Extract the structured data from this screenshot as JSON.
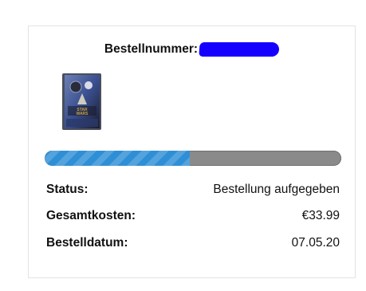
{
  "order": {
    "number_label": "Bestellnummer:",
    "number_redaction_color": "#1500ff"
  },
  "product": {
    "thumbnail_icon": "star-wars-steelbook-image",
    "thumbnail_colors": [
      "#3a4f8f",
      "#6b7fb5",
      "#1b1d2e",
      "#c9a24a"
    ]
  },
  "progress": {
    "fraction": 0.49,
    "fill_color": "#2f8fd6",
    "track_color": "#8a8a8a"
  },
  "details": {
    "status_label": "Status:",
    "status_value": "Bestellung aufgegeben",
    "total_label": "Gesamtkosten:",
    "total_value": "€33.99",
    "date_label": "Bestelldatum:",
    "date_value": "07.05.20"
  }
}
